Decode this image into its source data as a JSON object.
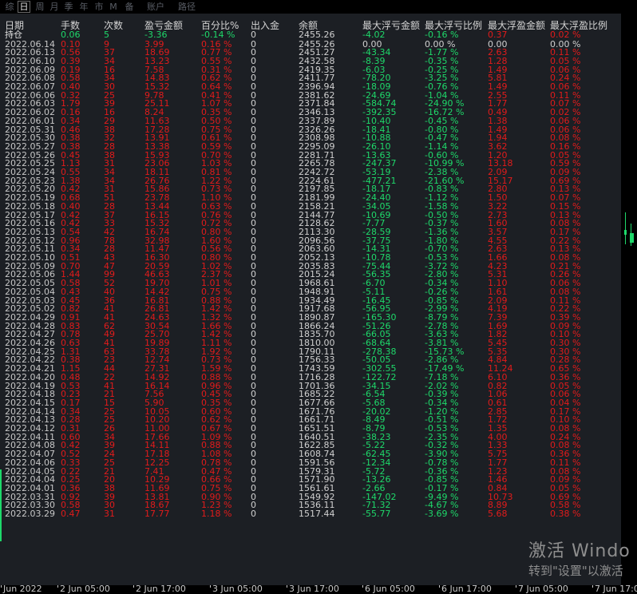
{
  "tabs": [
    {
      "label": "综",
      "active": false
    },
    {
      "label": "日",
      "active": true
    },
    {
      "label": "周",
      "active": false
    },
    {
      "label": "月",
      "active": false
    },
    {
      "label": "季",
      "active": false
    },
    {
      "label": "年",
      "active": false
    },
    {
      "label": "市",
      "active": false
    },
    {
      "label": "M",
      "active": false
    },
    {
      "label": "备",
      "active": false
    },
    {
      "label": "账户",
      "active": false
    },
    {
      "label": "路径",
      "active": false
    }
  ],
  "table": {
    "headers": [
      "日期",
      "手数",
      "次数",
      "盈亏金额",
      "百分比%",
      "出入金",
      "余额",
      "最大浮亏金额",
      "最大浮亏比例",
      "最大浮盈金额",
      "最大浮盈比例"
    ],
    "holding": [
      "持仓",
      "0.06",
      "5",
      "-3.36",
      "-0.14 %",
      "0",
      "2455.26",
      "-4.02",
      "-0.16 %",
      "0.37",
      "0.02 %"
    ],
    "rows": [
      [
        "2022.06.14",
        "0.10",
        "9",
        "3.99",
        "0.16 %",
        "0",
        "2455.26",
        "0.00",
        "0.00 %",
        "0.00",
        "0.00 %"
      ],
      [
        "2022.06.13",
        "0.56",
        "37",
        "18.69",
        "0.77 %",
        "0",
        "2451.27",
        "-43.34",
        "-1.77 %",
        "2.63",
        "0.11 %"
      ],
      [
        "2022.06.10",
        "0.39",
        "34",
        "13.23",
        "0.55 %",
        "0",
        "2432.58",
        "-8.39",
        "-0.35 %",
        "1.28",
        "0.05 %"
      ],
      [
        "2022.06.09",
        "0.19",
        "16",
        "7.58",
        "0.31 %",
        "0",
        "2419.35",
        "-6.03",
        "-0.25 %",
        "1.49",
        "0.06 %"
      ],
      [
        "2022.06.08",
        "0.58",
        "34",
        "14.83",
        "0.62 %",
        "0",
        "2411.77",
        "-78.20",
        "-3.25 %",
        "5.81",
        "0.24 %"
      ],
      [
        "2022.06.07",
        "0.40",
        "30",
        "15.32",
        "0.64 %",
        "0",
        "2396.94",
        "-18.09",
        "-0.76 %",
        "1.49",
        "0.06 %"
      ],
      [
        "2022.06.06",
        "0.32",
        "25",
        "9.78",
        "0.41 %",
        "0",
        "2381.62",
        "-24.69",
        "-1.04 %",
        "2.55",
        "0.11 %"
      ],
      [
        "2022.06.03",
        "1.79",
        "39",
        "25.11",
        "1.07 %",
        "0",
        "2371.84",
        "-584.74",
        "-24.90 %",
        "1.77",
        "0.07 %"
      ],
      [
        "2022.06.02",
        "0.16",
        "16",
        "8.24",
        "0.35 %",
        "0",
        "2346.13",
        "-392.35",
        "-16.72 %",
        "0.49",
        "0.02 %"
      ],
      [
        "2022.06.01",
        "0.34",
        "29",
        "11.63",
        "0.50 %",
        "0",
        "2337.89",
        "-10.40",
        "-0.45 %",
        "1.38",
        "0.06 %"
      ],
      [
        "2022.05.31",
        "0.46",
        "38",
        "17.28",
        "0.75 %",
        "0",
        "2326.26",
        "-18.41",
        "-0.80 %",
        "1.49",
        "0.06 %"
      ],
      [
        "2022.05.30",
        "0.38",
        "32",
        "13.91",
        "0.61 %",
        "0",
        "2308.98",
        "-10.88",
        "-0.47 %",
        "1.94",
        "0.08 %"
      ],
      [
        "2022.05.27",
        "0.38",
        "28",
        "13.38",
        "0.59 %",
        "0",
        "2295.09",
        "-26.10",
        "-1.14 %",
        "3.62",
        "0.16 %"
      ],
      [
        "2022.05.26",
        "0.45",
        "38",
        "15.93",
        "0.70 %",
        "0",
        "2281.71",
        "-13.63",
        "-0.60 %",
        "1.20",
        "0.05 %"
      ],
      [
        "2022.05.25",
        "1.13",
        "31",
        "23.06",
        "1.03 %",
        "0",
        "2265.78",
        "-247.37",
        "-10.99 %",
        "13.18",
        "0.59 %"
      ],
      [
        "2022.05.24",
        "0.55",
        "34",
        "18.11",
        "0.81 %",
        "0",
        "2242.72",
        "-53.19",
        "-2.38 %",
        "2.09",
        "0.09 %"
      ],
      [
        "2022.05.23",
        "1.38",
        "34",
        "26.76",
        "1.22 %",
        "0",
        "2224.61",
        "-477.21",
        "-21.60 %",
        "15.17",
        "0.69 %"
      ],
      [
        "2022.05.20",
        "0.42",
        "31",
        "15.86",
        "0.73 %",
        "0",
        "2197.85",
        "-18.17",
        "-0.83 %",
        "2.80",
        "0.13 %"
      ],
      [
        "2022.05.19",
        "0.68",
        "51",
        "23.78",
        "1.10 %",
        "0",
        "2181.99",
        "-24.40",
        "-1.12 %",
        "1.50",
        "0.07 %"
      ],
      [
        "2022.05.18",
        "0.40",
        "28",
        "13.44",
        "0.63 %",
        "0",
        "2158.21",
        "-34.05",
        "-1.58 %",
        "3.22",
        "0.15 %"
      ],
      [
        "2022.05.17",
        "0.42",
        "37",
        "16.15",
        "0.76 %",
        "0",
        "2144.77",
        "-10.69",
        "-0.50 %",
        "2.73",
        "0.13 %"
      ],
      [
        "2022.05.16",
        "0.42",
        "33",
        "15.32",
        "0.72 %",
        "0",
        "2128.62",
        "-7.77",
        "-0.37 %",
        "1.60",
        "0.08 %"
      ],
      [
        "2022.05.13",
        "0.54",
        "42",
        "16.74",
        "0.80 %",
        "0",
        "2113.30",
        "-28.59",
        "-1.36 %",
        "3.57",
        "0.17 %"
      ],
      [
        "2022.05.12",
        "0.96",
        "78",
        "32.98",
        "1.60 %",
        "0",
        "2096.56",
        "-37.75",
        "-1.80 %",
        "4.55",
        "0.22 %"
      ],
      [
        "2022.05.11",
        "0.34",
        "28",
        "11.47",
        "0.56 %",
        "0",
        "2063.60",
        "-14.31",
        "-0.70 %",
        "2.63",
        "0.13 %"
      ],
      [
        "2022.05.10",
        "0.51",
        "43",
        "16.30",
        "0.80 %",
        "0",
        "2052.13",
        "-10.78",
        "-0.53 %",
        "1.66",
        "0.08 %"
      ],
      [
        "2022.05.09",
        "0.70",
        "47",
        "20.59",
        "1.02 %",
        "0",
        "2035.83",
        "-75.44",
        "-3.72 %",
        "4.23",
        "0.21 %"
      ],
      [
        "2022.05.06",
        "1.44",
        "99",
        "46.63",
        "2.37 %",
        "0",
        "2015.24",
        "-56.35",
        "-2.80 %",
        "5.31",
        "0.26 %"
      ],
      [
        "2022.05.05",
        "0.58",
        "52",
        "19.70",
        "1.01 %",
        "0",
        "1968.61",
        "-6.70",
        "-0.34 %",
        "1.10",
        "0.06 %"
      ],
      [
        "2022.05.04",
        "0.43",
        "40",
        "14.42",
        "0.75 %",
        "0",
        "1948.91",
        "-5.11",
        "-0.26 %",
        "1.61",
        "0.08 %"
      ],
      [
        "2022.05.03",
        "0.45",
        "36",
        "16.81",
        "0.88 %",
        "0",
        "1934.49",
        "-16.45",
        "-0.85 %",
        "2.09",
        "0.11 %"
      ],
      [
        "2022.05.02",
        "0.82",
        "41",
        "26.81",
        "1.42 %",
        "0",
        "1917.68",
        "-56.95",
        "-2.99 %",
        "4.19",
        "0.22 %"
      ],
      [
        "2022.04.29",
        "0.91",
        "41",
        "24.63",
        "1.32 %",
        "0",
        "1890.87",
        "-165.30",
        "-8.79 %",
        "7.39",
        "0.39 %"
      ],
      [
        "2022.04.28",
        "0.83",
        "62",
        "30.54",
        "1.66 %",
        "0",
        "1866.24",
        "-51.26",
        "-2.78 %",
        "1.69",
        "0.09 %"
      ],
      [
        "2022.04.27",
        "0.78",
        "49",
        "25.70",
        "1.42 %",
        "0",
        "1835.70",
        "-66.05",
        "-3.63 %",
        "1.82",
        "0.10 %"
      ],
      [
        "2022.04.26",
        "0.63",
        "41",
        "19.89",
        "1.11 %",
        "0",
        "1810.00",
        "-68.64",
        "-3.81 %",
        "5.45",
        "0.30 %"
      ],
      [
        "2022.04.25",
        "1.31",
        "63",
        "33.78",
        "1.92 %",
        "0",
        "1790.11",
        "-278.38",
        "-15.73 %",
        "5.35",
        "0.30 %"
      ],
      [
        "2022.04.22",
        "0.38",
        "23",
        "12.74",
        "0.73 %",
        "0",
        "1756.33",
        "-50.05",
        "-2.86 %",
        "4.84",
        "0.28 %"
      ],
      [
        "2022.04.21",
        "1.15",
        "44",
        "27.31",
        "1.59 %",
        "0",
        "1743.59",
        "-302.55",
        "-17.49 %",
        "11.24",
        "0.65 %"
      ],
      [
        "2022.04.20",
        "0.48",
        "22",
        "14.92",
        "0.88 %",
        "0",
        "1716.28",
        "-122.72",
        "-7.18 %",
        "6.10",
        "0.36 %"
      ],
      [
        "2022.04.19",
        "0.53",
        "41",
        "16.14",
        "0.96 %",
        "0",
        "1701.36",
        "-34.15",
        "-2.02 %",
        "0.82",
        "0.05 %"
      ],
      [
        "2022.04.18",
        "0.23",
        "21",
        "7.56",
        "0.45 %",
        "0",
        "1685.22",
        "-6.54",
        "-0.39 %",
        "1.06",
        "0.06 %"
      ],
      [
        "2022.04.15",
        "0.17",
        "15",
        "5.90",
        "0.35 %",
        "0",
        "1677.66",
        "-5.68",
        "-0.34 %",
        "0.61",
        "0.04 %"
      ],
      [
        "2022.04.14",
        "0.34",
        "25",
        "10.05",
        "0.60 %",
        "0",
        "1671.76",
        "-20.02",
        "-1.20 %",
        "2.85",
        "0.17 %"
      ],
      [
        "2022.04.13",
        "0.28",
        "25",
        "10.20",
        "0.62 %",
        "0",
        "1661.71",
        "-8.49",
        "-0.51 %",
        "1.72",
        "0.10 %"
      ],
      [
        "2022.04.12",
        "0.31",
        "26",
        "11.00",
        "0.67 %",
        "0",
        "1651.51",
        "-8.79",
        "-0.53 %",
        "1.35",
        "0.08 %"
      ],
      [
        "2022.04.11",
        "0.60",
        "34",
        "17.66",
        "1.09 %",
        "0",
        "1640.51",
        "-38.23",
        "-2.35 %",
        "4.00",
        "0.24 %"
      ],
      [
        "2022.04.08",
        "0.42",
        "39",
        "14.11",
        "0.88 %",
        "0",
        "1622.85",
        "-5.22",
        "-0.32 %",
        "1.33",
        "0.08 %"
      ],
      [
        "2022.04.07",
        "0.52",
        "24",
        "17.18",
        "1.08 %",
        "0",
        "1608.74",
        "-62.45",
        "-3.90 %",
        "5.75",
        "0.36 %"
      ],
      [
        "2022.04.06",
        "0.33",
        "25",
        "12.25",
        "0.78 %",
        "0",
        "1591.56",
        "-12.34",
        "-0.78 %",
        "1.77",
        "0.11 %"
      ],
      [
        "2022.04.05",
        "0.22",
        "21",
        "7.41",
        "0.47 %",
        "0",
        "1579.31",
        "-5.72",
        "-0.36 %",
        "1.23",
        "0.08 %"
      ],
      [
        "2022.04.04",
        "0.25",
        "20",
        "10.29",
        "0.66 %",
        "0",
        "1571.90",
        "-13.26",
        "-0.85 %",
        "1.46",
        "0.09 %"
      ],
      [
        "2022.04.01",
        "0.36",
        "38",
        "11.69",
        "0.75 %",
        "0",
        "1561.61",
        "-2.66",
        "-0.17 %",
        "0.84",
        "0.05 %"
      ],
      [
        "2022.03.31",
        "0.92",
        "39",
        "13.81",
        "0.90 %",
        "0",
        "1549.92",
        "-147.02",
        "-9.49 %",
        "10.73",
        "0.69 %"
      ],
      [
        "2022.03.30",
        "0.58",
        "30",
        "18.67",
        "1.23 %",
        "0",
        "1536.11",
        "-71.32",
        "-4.67 %",
        "8.89",
        "0.58 %"
      ],
      [
        "2022.03.29",
        "0.47",
        "31",
        "17.77",
        "1.18 %",
        "0",
        "1517.44",
        "-55.77",
        "-3.69 %",
        "5.68",
        "0.38 %"
      ]
    ]
  },
  "xaxis": [
    "Jun 2022",
    "2 Jun 05:00",
    "2 Jun 17:00",
    "3 Jun 05:00",
    "3 Jun 17:00",
    "6 Jun 05:00",
    "6 Jun 17:00",
    "7 Jun 05:00",
    "7 Jun 17:00"
  ],
  "watermark": {
    "line1": "激活 Windo",
    "line2": "转到\"设置\"以激活"
  },
  "colors": {
    "positive": "#1ed86a",
    "negative": "#e21b1b",
    "panel_bg": "#1c1f24",
    "text": "#c7c7c7"
  }
}
